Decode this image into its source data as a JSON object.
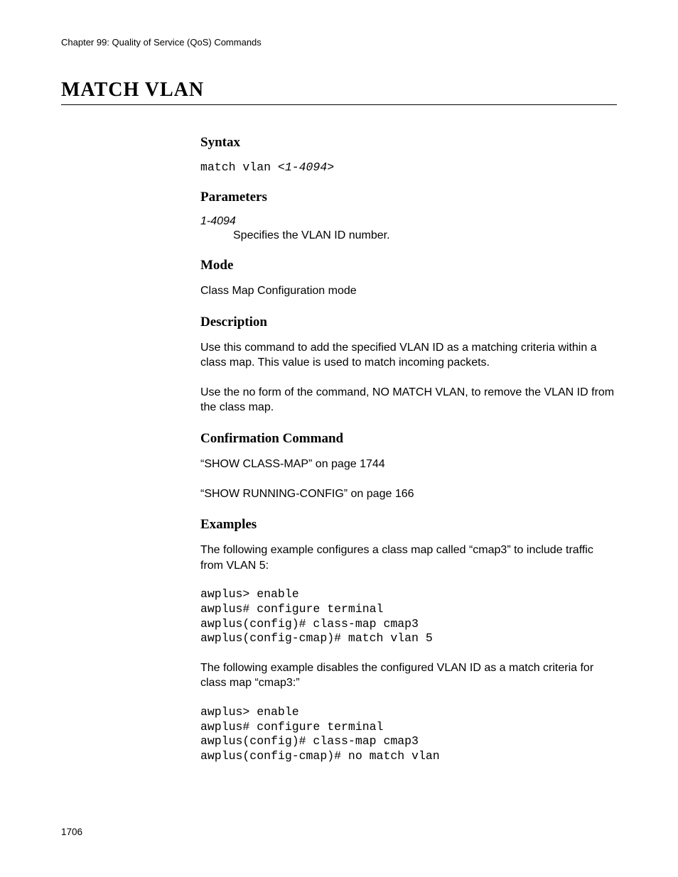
{
  "chapter_header": "Chapter 99: Quality of Service (QoS) Commands",
  "title": "MATCH VLAN",
  "syntax": {
    "heading": "Syntax",
    "prefix": "match vlan <",
    "arg": "1-4094",
    "suffix": ">"
  },
  "parameters": {
    "heading": "Parameters",
    "name": "1-4094",
    "desc": "Specifies the VLAN ID number."
  },
  "mode": {
    "heading": "Mode",
    "text": "Class Map Configuration mode"
  },
  "description": {
    "heading": "Description",
    "p1": "Use this command to add the specified VLAN ID as a matching criteria within a class map. This value is used to match incoming packets.",
    "p2": "Use the no form of the command, NO MATCH VLAN, to remove the VLAN ID from the class map."
  },
  "confirmation": {
    "heading": "Confirmation Command",
    "link1": "“SHOW CLASS-MAP” on page 1744",
    "link2": "“SHOW RUNNING-CONFIG” on page 166"
  },
  "examples": {
    "heading": "Examples",
    "intro1": "The following example configures a class map called “cmap3” to include traffic from VLAN 5:",
    "code1": "awplus> enable\nawplus# configure terminal\nawplus(config)# class-map cmap3\nawplus(config-cmap)# match vlan 5",
    "intro2": "The following example disables the configured VLAN ID as a match criteria for class map “cmap3:”",
    "code2": "awplus> enable\nawplus# configure terminal\nawplus(config)# class-map cmap3\nawplus(config-cmap)# no match vlan"
  },
  "page_number": "1706"
}
